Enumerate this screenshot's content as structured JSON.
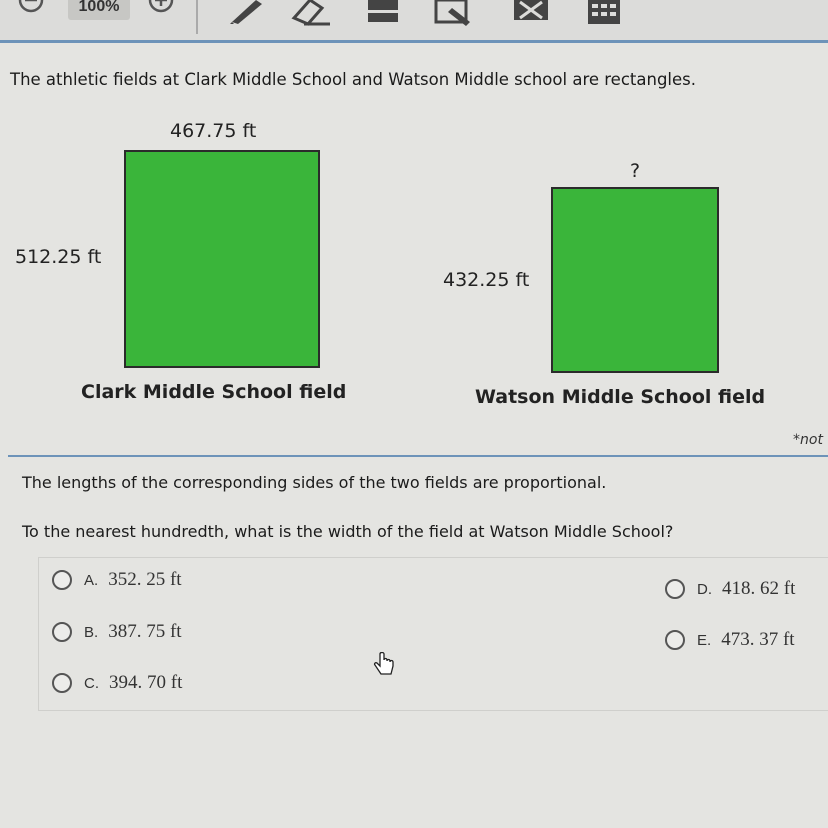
{
  "toolbar": {
    "zoom": "100%",
    "icons": [
      "zoom-out-icon",
      "zoom-in-icon",
      "pencil-icon",
      "eraser-icon",
      "highlighter-icon",
      "annotate-icon",
      "answer-eliminator-icon",
      "calculator-icon"
    ]
  },
  "question": {
    "intro": "The athletic fields at Clark Middle School and Watson Middle school are rectangles.",
    "clark": {
      "width": "467.75 ft",
      "length": "512.25 ft",
      "label": "Clark Middle School field"
    },
    "watson": {
      "width": "?",
      "length": "432.25 ft",
      "label": "Watson Middle School field"
    },
    "note": "*not",
    "line1": "The lengths of the corresponding sides of the two fields are proportional.",
    "line2": "To the nearest hundredth, what is the width of the field at Watson Middle School?"
  },
  "choices": [
    {
      "letter": "A.",
      "value": "352. 25 ft"
    },
    {
      "letter": "B.",
      "value": "387. 75 ft"
    },
    {
      "letter": "C.",
      "value": "394. 70 ft"
    },
    {
      "letter": "D.",
      "value": "418. 62 ft"
    },
    {
      "letter": "E.",
      "value": "473. 37 ft"
    }
  ],
  "colors": {
    "field_green": "#3ab53a",
    "accent_line": "#6d93b9"
  }
}
